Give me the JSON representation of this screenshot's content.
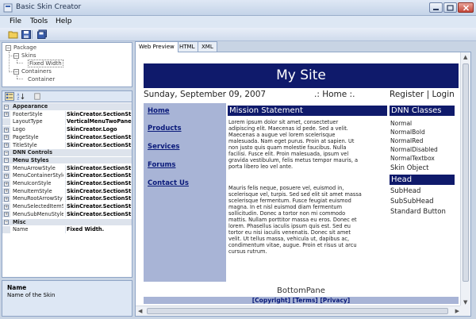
{
  "window": {
    "title": "Basic Skin Creator"
  },
  "menu": {
    "file": "File",
    "tools": "Tools",
    "help": "Help"
  },
  "toolbar": {
    "buttons": [
      {
        "icon": "open-folder-icon"
      },
      {
        "icon": "save-icon"
      },
      {
        "icon": "save-all-icon"
      }
    ]
  },
  "tree": {
    "package": "Package",
    "skins": "Skins",
    "fixed_width": "Fixed Width",
    "containers": "Containers",
    "container": "Container"
  },
  "properties": {
    "rows": [
      {
        "type": "cat",
        "name": "Appearance"
      },
      {
        "type": "prop",
        "name": "FooterStyle",
        "value": "SkinCreator.SectionSt",
        "expand": true
      },
      {
        "type": "prop",
        "name": "LayoutType",
        "value": "VerticalMenuTwoPane",
        "expand": false
      },
      {
        "type": "prop",
        "name": "Logo",
        "value": "SkinCreator.Logo",
        "expand": true
      },
      {
        "type": "prop",
        "name": "PageStyle",
        "value": "SkinCreator.SectionSt",
        "expand": true
      },
      {
        "type": "prop",
        "name": "TitleStyle",
        "value": "SkinCreator.SectionSt",
        "expand": true
      },
      {
        "type": "cat",
        "name": "DNN Controls"
      },
      {
        "type": "cat",
        "name": "Menu Styles"
      },
      {
        "type": "prop",
        "name": "MenuArrowStyle",
        "value": "SkinCreator.SectionSt",
        "expand": true
      },
      {
        "type": "prop",
        "name": "MenuContainerStyle",
        "value": "SkinCreator.SectionSt",
        "expand": true
      },
      {
        "type": "prop",
        "name": "MenuIconStyle",
        "value": "SkinCreator.SectionSt",
        "expand": true
      },
      {
        "type": "prop",
        "name": "MenuItemStyle",
        "value": "SkinCreator.SectionSt",
        "expand": true
      },
      {
        "type": "prop",
        "name": "MenuRootArrowSty",
        "value": "SkinCreator.SectionSt",
        "expand": true
      },
      {
        "type": "prop",
        "name": "MenuSelectedItemS",
        "value": "SkinCreator.SectionSt",
        "expand": true
      },
      {
        "type": "prop",
        "name": "MenuSubMenuStyle",
        "value": "SkinCreator.SectionSt",
        "expand": true
      },
      {
        "type": "cat",
        "name": "Misc"
      },
      {
        "type": "prop",
        "name": "Name",
        "value": "Fixed Width.",
        "expand": false
      }
    ],
    "desc_title": "Name",
    "desc_text": "Name of the Skin"
  },
  "tabs": {
    "web_preview": "Web Preview",
    "html": "HTML",
    "xml": "XML"
  },
  "site": {
    "title": "My Site",
    "date": "Sunday, September 09, 2007",
    "home": ".: Home :.",
    "register_login": "Register | Login",
    "nav": [
      "Home",
      "Products",
      "Services",
      "Forums",
      "Contact Us"
    ],
    "mission_title": "Mission Statement",
    "mission_para1": [
      "Lorem ipsum dolor sit amet, consectetuer",
      "adipiscing elit. Maecenas id pede. Sed a velit.",
      "Maecenas a augue vel lorem scelerisque",
      "malesuada. Nam eget purus. Proin at sapien. Ut",
      "non justo quis quam molestie faucibus. Nulla",
      "facilisi. Fusce elit. Proin malesuada, ipsum vel",
      "gravida vestibulum, felis metus tempor mauris, a",
      "porta libero leo vel ante."
    ],
    "mission_para2": [
      "Mauris felis neque, posuere vel, euismod in,",
      "scelerisque vel, turpis. Sed sed elit sit amet massa",
      "scelerisque fermentum. Fusce feugiat euismod",
      "magna. In et nisl euismod diam fermentum",
      "sollicitudin. Donec a tortor non mi commodo",
      "mattis. Nullam porttitor massa eu eros. Donec et",
      "lorem. Phasellus iaculis ipsum quis est. Sed eu",
      "tortor eu nisi iaculis venenatis. Donec sit amet",
      "velit. Ut tellus massa, vehicula ut, dapibus ac,",
      "condimentum vitae, augue. Proin et risus ut arcu",
      "cursus rutrum."
    ],
    "dnn_title": "DNN Classes",
    "dnn_items": [
      "Normal",
      "NormalBold",
      "NormalRed",
      "NormalDisabled",
      "NormalTextbox",
      "Skin Object"
    ],
    "head_title": "Head",
    "head_items": [
      "SubHead",
      "SubSubHead",
      "Standard Button"
    ],
    "bottom_pane": "BottomPane",
    "footer_links": "[Copyright] [Terms] [Privacy]"
  },
  "colors": {
    "accent": "#0f1a6b",
    "nav_bg": "#a8b4d6",
    "chrome": "#c8d4e4"
  }
}
